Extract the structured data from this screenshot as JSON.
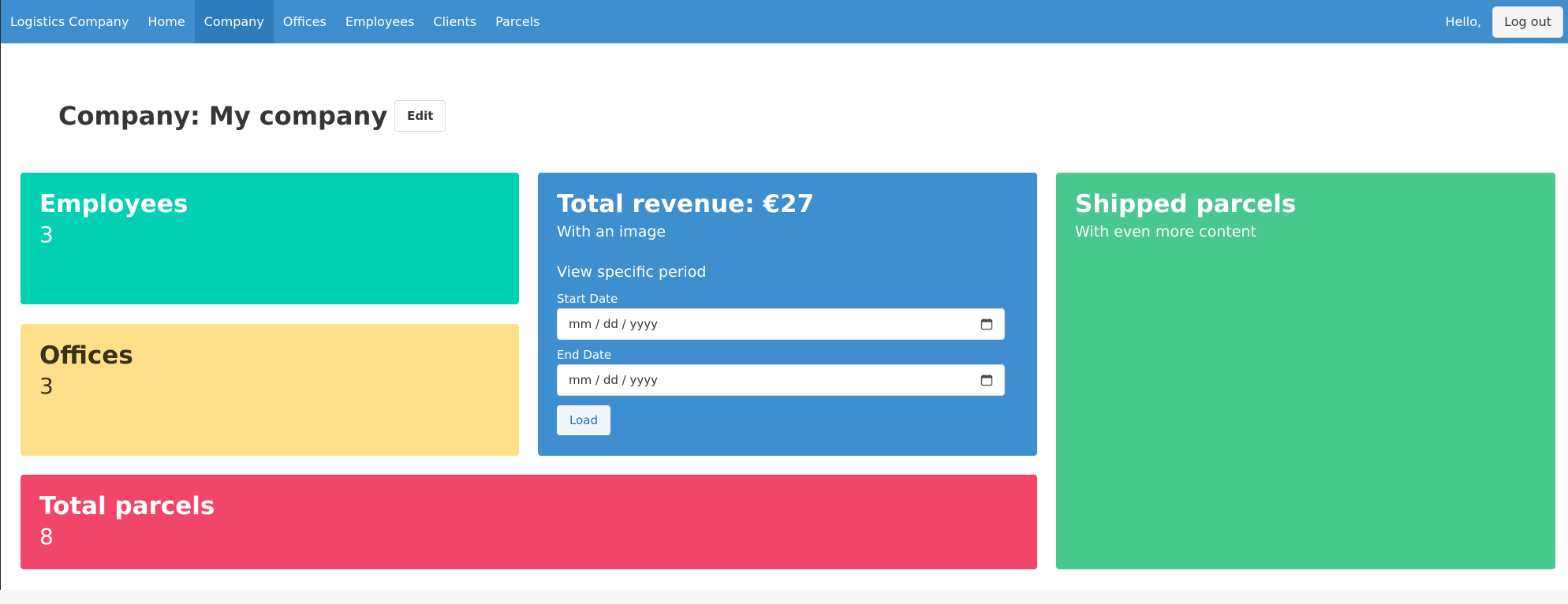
{
  "navbar": {
    "brand": "Logistics Company",
    "items": [
      {
        "label": "Home",
        "active": false
      },
      {
        "label": "Company",
        "active": true
      },
      {
        "label": "Offices",
        "active": false
      },
      {
        "label": "Employees",
        "active": false
      },
      {
        "label": "Clients",
        "active": false
      },
      {
        "label": "Parcels",
        "active": false
      }
    ],
    "greeting": "Hello,",
    "logout_label": "Log out"
  },
  "page": {
    "title": "Company: My company",
    "edit_label": "Edit"
  },
  "tiles": {
    "employees": {
      "title": "Employees",
      "value": "3"
    },
    "offices": {
      "title": "Offices",
      "value": "3"
    },
    "total_parcels": {
      "title": "Total parcels",
      "value": "8"
    },
    "revenue": {
      "title": "Total revenue: €27",
      "subtitle": "With an image",
      "period_label": "View specific period",
      "start_label": "Start Date",
      "start_placeholder": "mm / dd / yyyy",
      "end_label": "End Date",
      "end_placeholder": "mm / dd / yyyy",
      "load_label": "Load"
    },
    "shipped": {
      "title": "Shipped parcels",
      "subtitle": "With even more content"
    }
  },
  "colors": {
    "navbar": "#3e8ed0",
    "employees": "#00d1b2",
    "offices": "#ffe08a",
    "total_parcels": "#f14668",
    "revenue": "#3e8ed0",
    "shipped": "#48c78e"
  },
  "icons": {
    "date_picker": "calendar-icon"
  }
}
